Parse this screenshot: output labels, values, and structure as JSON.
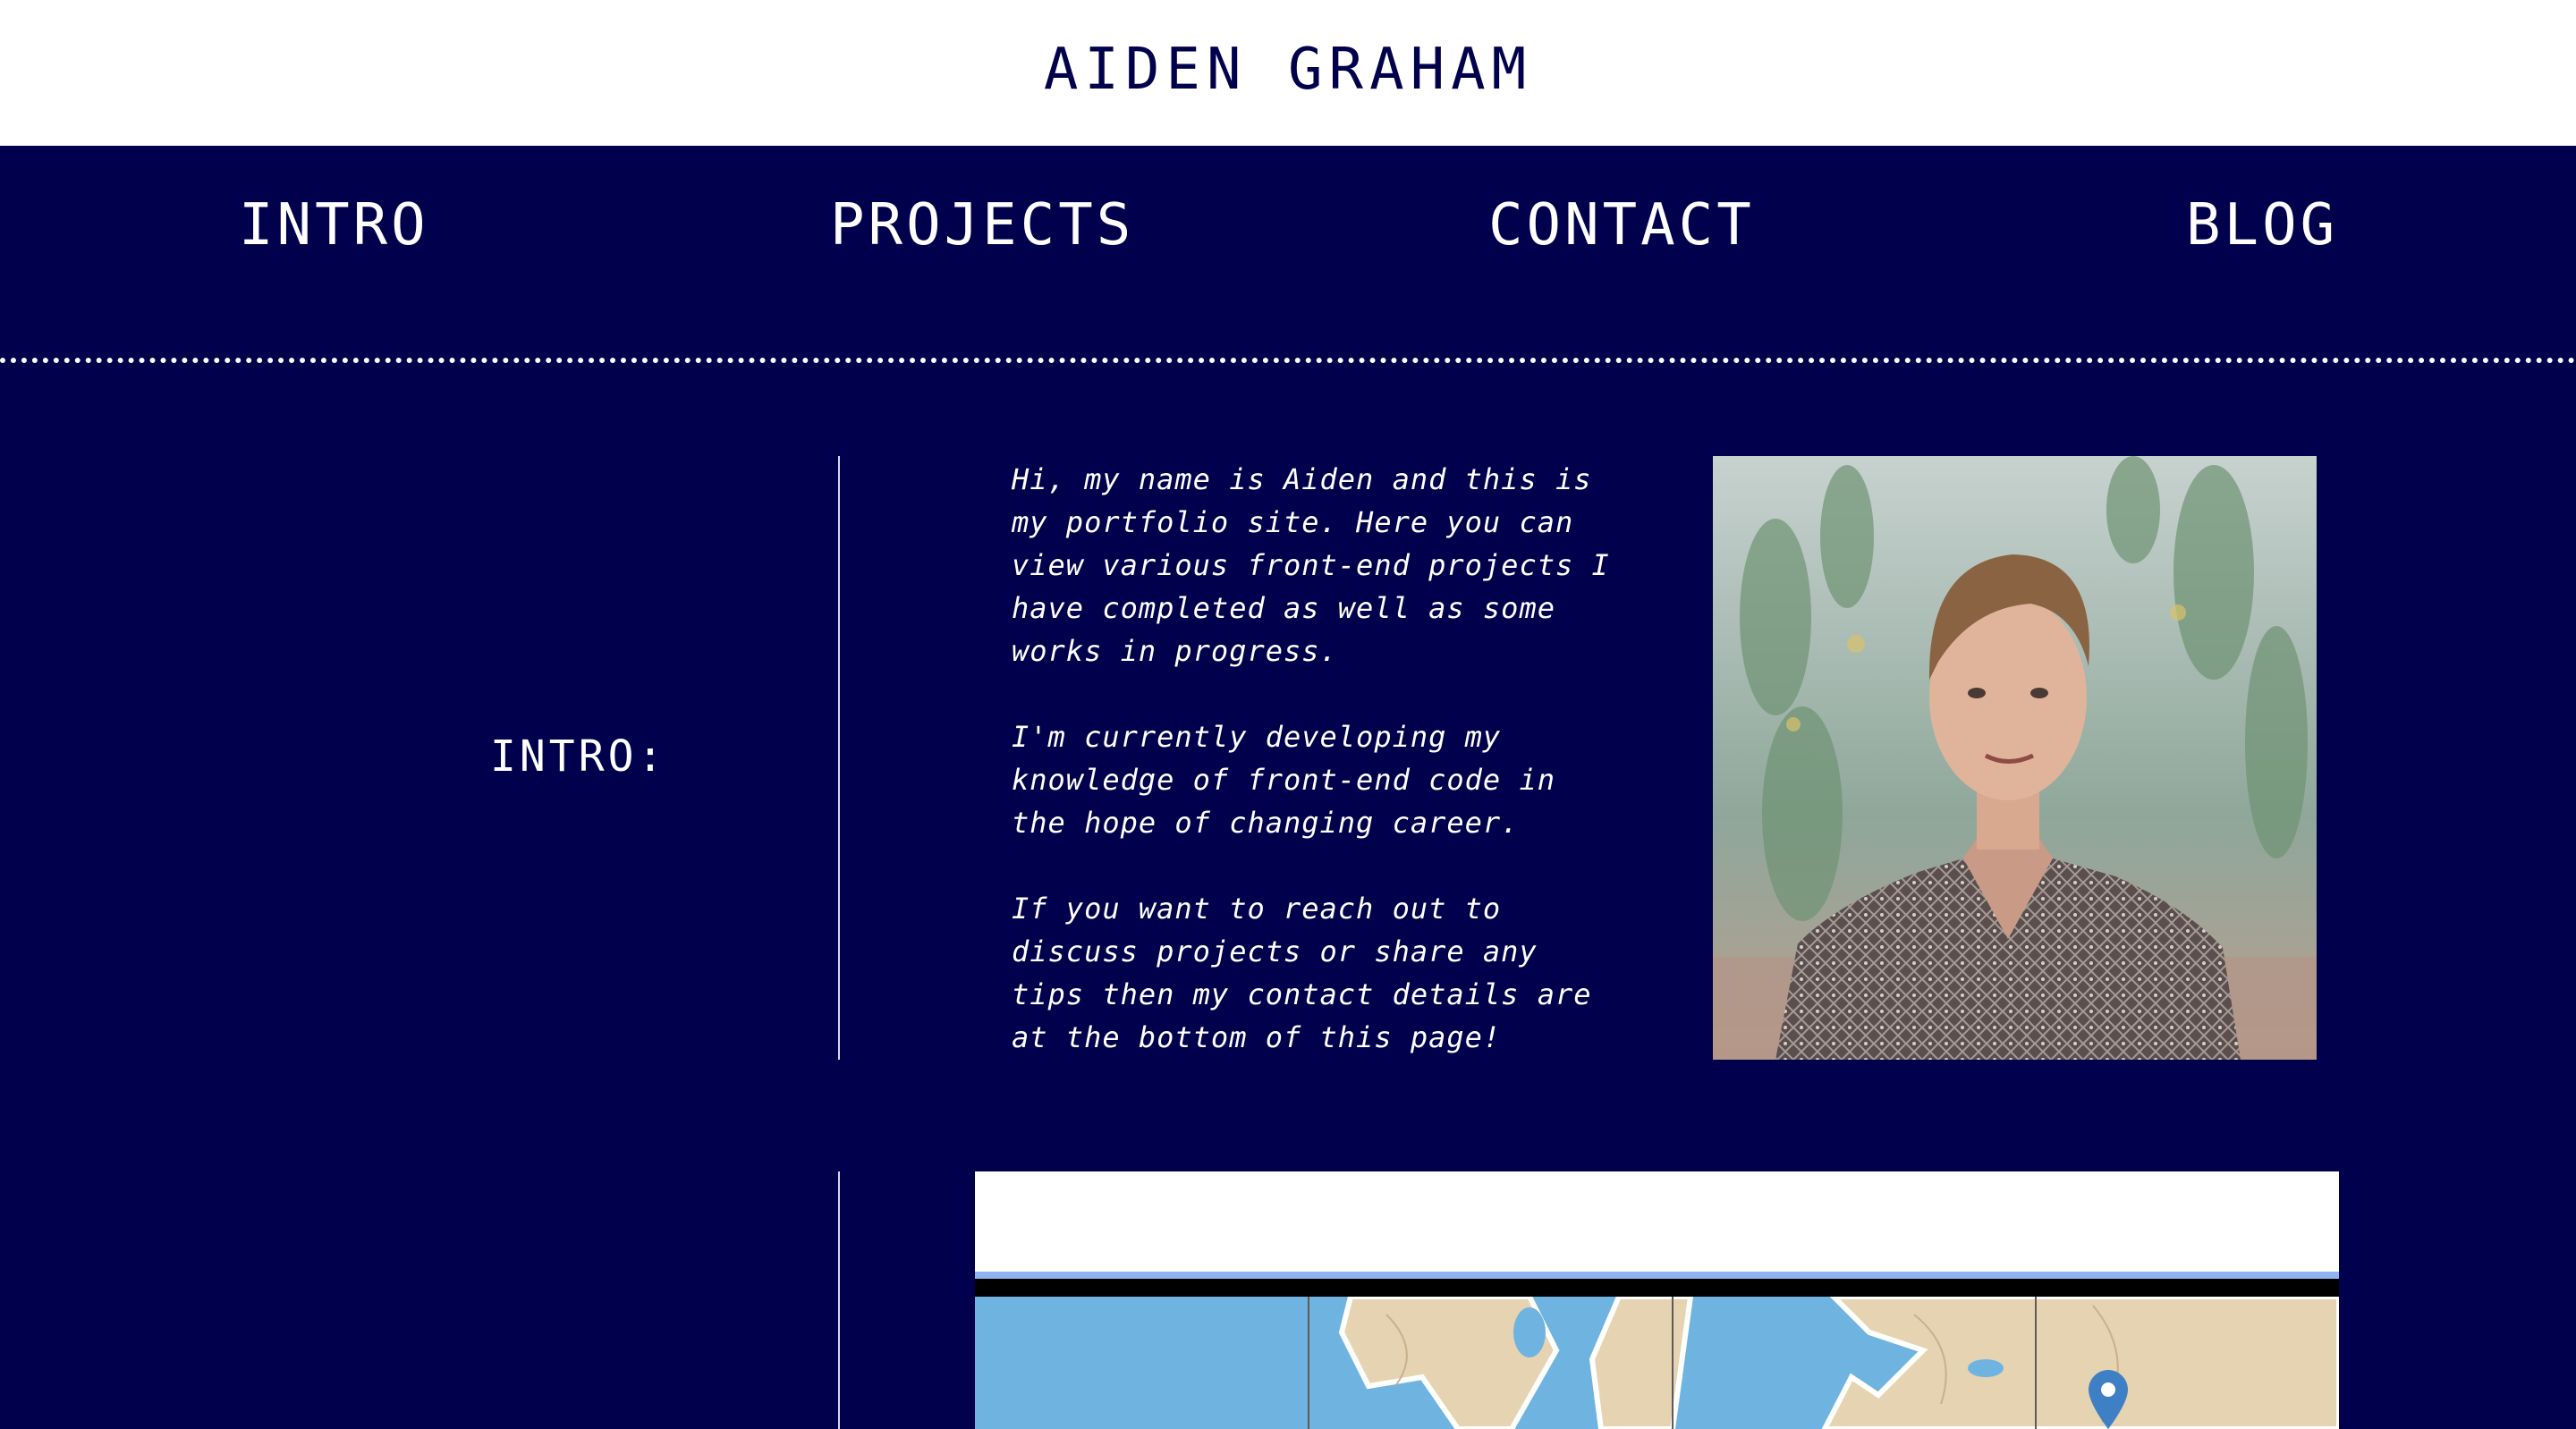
{
  "header": {
    "title": "AIDEN GRAHAM"
  },
  "nav": {
    "items": [
      {
        "label": "INTRO"
      },
      {
        "label": "PROJECTS"
      },
      {
        "label": "CONTACT"
      },
      {
        "label": "BLOG"
      }
    ]
  },
  "intro": {
    "label": "INTRO:",
    "paragraphs": [
      "Hi, my name is Aiden and this is my portfolio site. Here you can view various front-end projects I have completed as well as some works in progress.",
      "I'm currently developing my knowledge of front-end code in the hope of changing career.",
      "If you want to reach out to discuss projects or share any tips then my contact details are at the bottom of this page!"
    ]
  },
  "colors": {
    "background": "#00004c",
    "header_bg": "#ffffff",
    "text": "#ffffff",
    "title": "#00004c"
  },
  "icons": {
    "map_marker": "map-pin-icon"
  }
}
